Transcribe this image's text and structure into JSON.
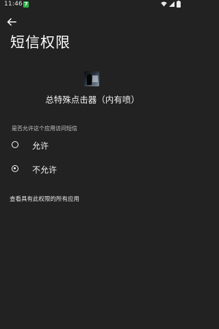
{
  "status_bar": {
    "time": "11:46",
    "app_badge": "7"
  },
  "page": {
    "title": "短信权限"
  },
  "app": {
    "name": "总特殊点击器（内有喷）"
  },
  "permission": {
    "question": "是否允许这个应用访问短信",
    "options": [
      {
        "label": "允许",
        "selected": false
      },
      {
        "label": "不允许",
        "selected": true
      }
    ],
    "all_apps_link": "查看具有此权限的所有应用"
  },
  "colors": {
    "background": "#222222",
    "text": "#ffffff",
    "badge": "#2fb24c"
  }
}
